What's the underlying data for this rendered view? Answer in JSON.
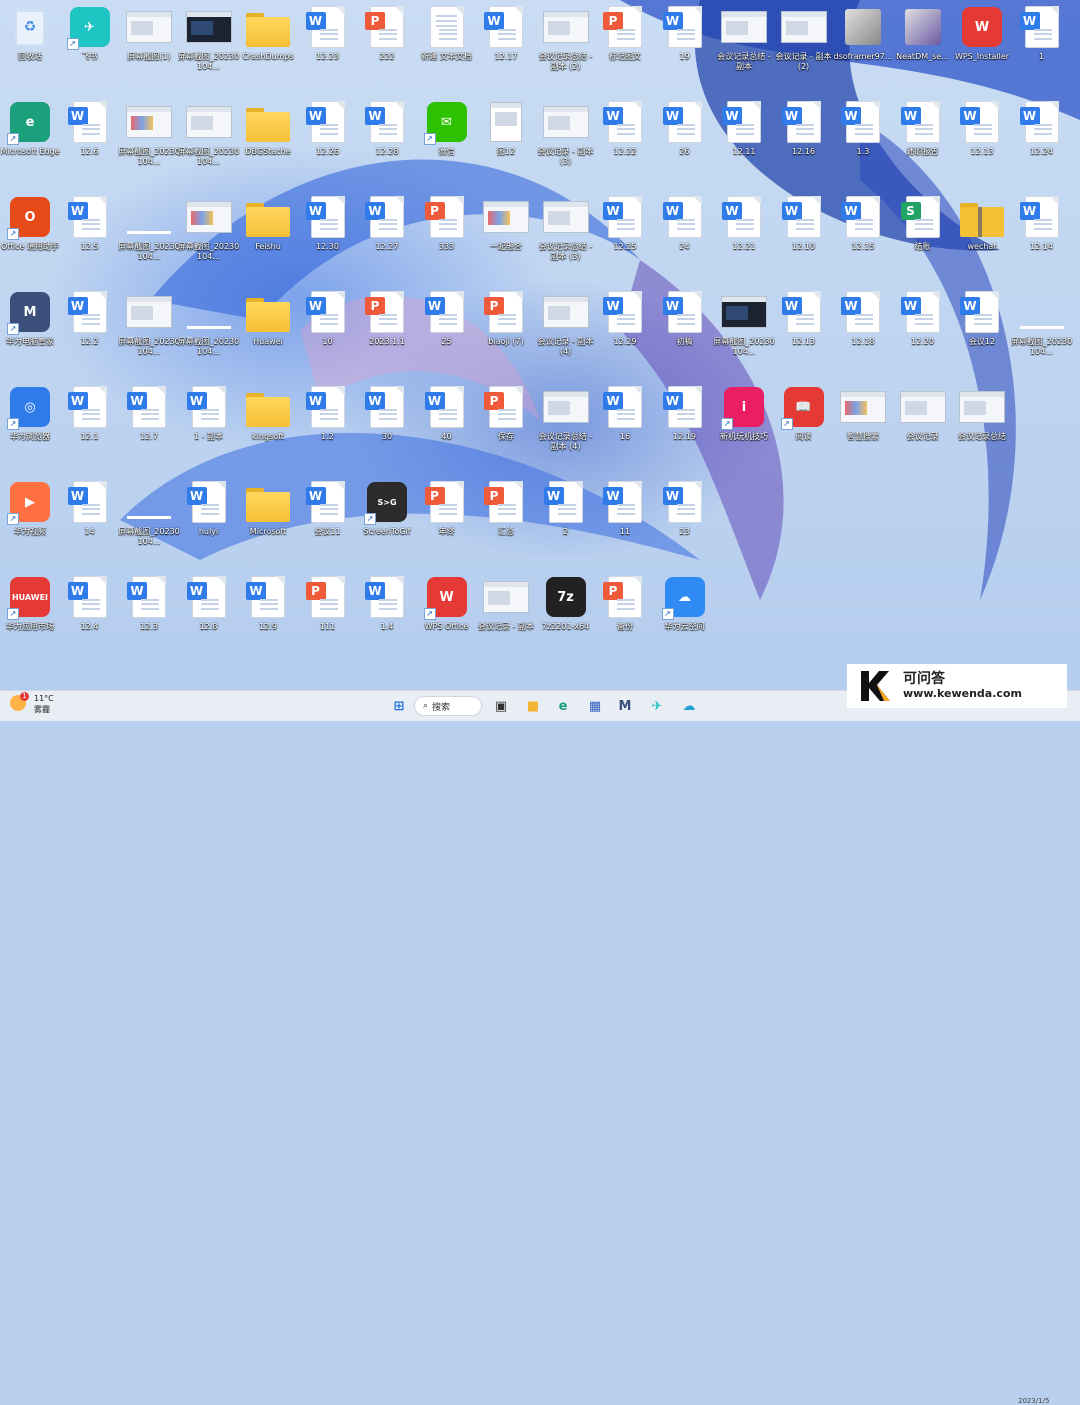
{
  "desktop": {
    "icons": [
      {
        "label": "回收站",
        "kind": "recycle",
        "accent": "#4a90e2"
      },
      {
        "label": "飞书",
        "kind": "app",
        "accent": "#1ec5c2",
        "glyph": "✈",
        "shortcut": true
      },
      {
        "label": "屏幕截图(1)",
        "kind": "shot"
      },
      {
        "label": "屏幕截图_20230104...",
        "kind": "shot",
        "variant": "dark"
      },
      {
        "label": "CrashDumps",
        "kind": "folder"
      },
      {
        "label": "12.23",
        "kind": "word"
      },
      {
        "label": "222",
        "kind": "ppt"
      },
      {
        "label": "新建 文本文档",
        "kind": "txt"
      },
      {
        "label": "12.17",
        "kind": "word"
      },
      {
        "label": "会议记录总结 - 副本 (2)",
        "kind": "shot"
      },
      {
        "label": "标记图文",
        "kind": "ppt"
      },
      {
        "label": "19",
        "kind": "word"
      },
      {
        "label": "会议记录总结 - 副本",
        "kind": "shot"
      },
      {
        "label": "会议记录 - 副本 (2)",
        "kind": "shot"
      },
      {
        "label": "dsoframer97...",
        "kind": "installer",
        "accent": "#888888"
      },
      {
        "label": "NeatDM_se...",
        "kind": "installer",
        "accent": "#6b5aa6"
      },
      {
        "label": "WPS_Installer",
        "kind": "app",
        "accent": "#e53935",
        "glyph": "W"
      },
      {
        "label": "1",
        "kind": "word"
      },
      {
        "label": "Microsoft Edge",
        "kind": "app",
        "accent": "#1aa07a",
        "glyph": "e",
        "shortcut": true
      },
      {
        "label": "12.6",
        "kind": "word"
      },
      {
        "label": "屏幕截图_20230104...",
        "kind": "shot",
        "variant": "color"
      },
      {
        "label": "屏幕截图_20230104...",
        "kind": "shot"
      },
      {
        "label": "DBGStache",
        "kind": "folder"
      },
      {
        "label": "12.26",
        "kind": "word"
      },
      {
        "label": "12.28",
        "kind": "word"
      },
      {
        "label": "微信",
        "kind": "app",
        "accent": "#2dc100",
        "glyph": "✉",
        "shortcut": true
      },
      {
        "label": "图12",
        "kind": "image"
      },
      {
        "label": "会议记录 - 副本 (3)",
        "kind": "shot"
      },
      {
        "label": "12.22",
        "kind": "word"
      },
      {
        "label": "26",
        "kind": "word"
      },
      {
        "label": "12.11",
        "kind": "word"
      },
      {
        "label": "12.16",
        "kind": "word"
      },
      {
        "label": "1.3",
        "kind": "word"
      },
      {
        "label": "述职报告",
        "kind": "word"
      },
      {
        "label": "12.13",
        "kind": "word"
      },
      {
        "label": "12.24",
        "kind": "word"
      },
      {
        "label": "Office 通用助手",
        "kind": "app",
        "accent": "#e64a19",
        "glyph": "O",
        "shortcut": true
      },
      {
        "label": "12.5",
        "kind": "word"
      },
      {
        "label": "屏幕截图_20230104...",
        "kind": "blank"
      },
      {
        "label": "屏幕截图_20230104...",
        "kind": "shot",
        "variant": "color"
      },
      {
        "label": "Feishu",
        "kind": "folder"
      },
      {
        "label": "12.30",
        "kind": "word"
      },
      {
        "label": "12.27",
        "kind": "word"
      },
      {
        "label": "333",
        "kind": "ppt"
      },
      {
        "label": "一起融合",
        "kind": "shot",
        "variant": "color"
      },
      {
        "label": "会议记录总结 - 副本 (3)",
        "kind": "shot"
      },
      {
        "label": "12.25",
        "kind": "word"
      },
      {
        "label": "24",
        "kind": "word"
      },
      {
        "label": "12.21",
        "kind": "word"
      },
      {
        "label": "12.10",
        "kind": "word"
      },
      {
        "label": "12.15",
        "kind": "word"
      },
      {
        "label": "结账",
        "kind": "sheet"
      },
      {
        "label": "wechat",
        "kind": "zip"
      },
      {
        "label": "12.14",
        "kind": "word"
      },
      {
        "label": "华为电脑管家",
        "kind": "app",
        "accent": "#3c4f7a",
        "glyph": "M",
        "shortcut": true
      },
      {
        "label": "12.2",
        "kind": "word"
      },
      {
        "label": "屏幕截图_20230104...",
        "kind": "shot"
      },
      {
        "label": "屏幕截图_20230104...",
        "kind": "blank"
      },
      {
        "label": "Huawei",
        "kind": "folder"
      },
      {
        "label": "10",
        "kind": "word"
      },
      {
        "label": "2023.1.1",
        "kind": "ppt"
      },
      {
        "label": "25",
        "kind": "word"
      },
      {
        "label": "biaoji (7)",
        "kind": "ppt"
      },
      {
        "label": "会议记录 - 副本 (4)",
        "kind": "shot"
      },
      {
        "label": "12.29",
        "kind": "word"
      },
      {
        "label": "初稿",
        "kind": "word"
      },
      {
        "label": "屏幕截图_20230104...",
        "kind": "shot",
        "variant": "dark"
      },
      {
        "label": "12.13",
        "kind": "word"
      },
      {
        "label": "12.18",
        "kind": "word"
      },
      {
        "label": "12.20",
        "kind": "word"
      },
      {
        "label": "会议12",
        "kind": "word"
      },
      {
        "label": "屏幕截图_20230104...",
        "kind": "blank"
      },
      {
        "label": "华为浏览器",
        "kind": "app",
        "accent": "#2f7be9",
        "glyph": "◎",
        "shortcut": true
      },
      {
        "label": "12.1",
        "kind": "word"
      },
      {
        "label": "12.7",
        "kind": "word"
      },
      {
        "label": "1 - 副本",
        "kind": "word"
      },
      {
        "label": "kingsoft",
        "kind": "folder"
      },
      {
        "label": "1.2",
        "kind": "word"
      },
      {
        "label": "30",
        "kind": "word"
      },
      {
        "label": "40",
        "kind": "word"
      },
      {
        "label": "保存",
        "kind": "ppt"
      },
      {
        "label": "会议记录总结 - 副本 (4)",
        "kind": "shot"
      },
      {
        "label": "16",
        "kind": "word"
      },
      {
        "label": "12.19",
        "kind": "word"
      },
      {
        "label": "新机玩机技巧",
        "kind": "app",
        "accent": "#e91e63",
        "glyph": "i",
        "shortcut": true
      },
      {
        "label": "阅读",
        "kind": "app",
        "accent": "#e53935",
        "glyph": "📖",
        "shortcut": true
      },
      {
        "label": "智慧搜索",
        "kind": "shot",
        "variant": "color"
      },
      {
        "label": "会议记录",
        "kind": "shot"
      },
      {
        "label": "会议记录总结",
        "kind": "shot"
      },
      {
        "label": "华为视频",
        "kind": "app",
        "accent": "#ff7043",
        "glyph": "▶",
        "shortcut": true
      },
      {
        "label": "14",
        "kind": "word"
      },
      {
        "label": "屏幕截图_20230104...",
        "kind": "blank"
      },
      {
        "label": "hulyi",
        "kind": "word"
      },
      {
        "label": "Microsoft",
        "kind": "folder"
      },
      {
        "label": "会议11",
        "kind": "word"
      },
      {
        "label": "ScreenToGif",
        "kind": "app",
        "accent": "#2b2b2b",
        "glyph": "S>G",
        "shortcut": true
      },
      {
        "label": "年终",
        "kind": "ppt"
      },
      {
        "label": "汇总",
        "kind": "ppt"
      },
      {
        "label": "2",
        "kind": "word"
      },
      {
        "label": "11",
        "kind": "word"
      },
      {
        "label": "23",
        "kind": "word"
      },
      {
        "label": "华为应用市场",
        "kind": "app",
        "accent": "#e53935",
        "glyph": "HUAWEI",
        "shortcut": true
      },
      {
        "label": "12.4",
        "kind": "word"
      },
      {
        "label": "12.3",
        "kind": "word"
      },
      {
        "label": "12.8",
        "kind": "word"
      },
      {
        "label": "12.9",
        "kind": "word"
      },
      {
        "label": "111",
        "kind": "ppt"
      },
      {
        "label": "1.4",
        "kind": "word"
      },
      {
        "label": "WPS Office",
        "kind": "app",
        "accent": "#e53935",
        "glyph": "W",
        "shortcut": true
      },
      {
        "label": "会议记录 - 副本",
        "kind": "shot"
      },
      {
        "label": "7z2201-x64",
        "kind": "app",
        "accent": "#222222",
        "glyph": "7z"
      },
      {
        "label": "备份",
        "kind": "ppt"
      },
      {
        "label": "华为云空间",
        "kind": "app",
        "accent": "#2f8af5",
        "glyph": "☁",
        "shortcut": true
      }
    ]
  },
  "taskbar": {
    "weather_temp": "11°C",
    "weather_desc": "雾霾",
    "weather_badge": "1",
    "search_label": "搜索",
    "clock": "2023/1/5",
    "apps": [
      {
        "name": "start-button",
        "glyph": "⊞",
        "color": "#1e6fe0"
      },
      {
        "name": "task-view-button",
        "glyph": "▣",
        "color": "#333333"
      },
      {
        "name": "file-explorer-button",
        "glyph": "■",
        "color": "#f2b632"
      },
      {
        "name": "edge-button",
        "glyph": "e",
        "color": "#1aa07a"
      },
      {
        "name": "store-button",
        "glyph": "▦",
        "color": "#2f5fbf"
      },
      {
        "name": "pc-manager-button",
        "glyph": "M",
        "color": "#3c4f7a"
      },
      {
        "name": "feishu-button",
        "glyph": "✈",
        "color": "#1ec5c2"
      },
      {
        "name": "cloud-button",
        "glyph": "☁",
        "color": "#1e9fd6"
      }
    ]
  },
  "watermark": {
    "letter": "K",
    "cn": "可问答",
    "url": "www.kewenda.com"
  }
}
